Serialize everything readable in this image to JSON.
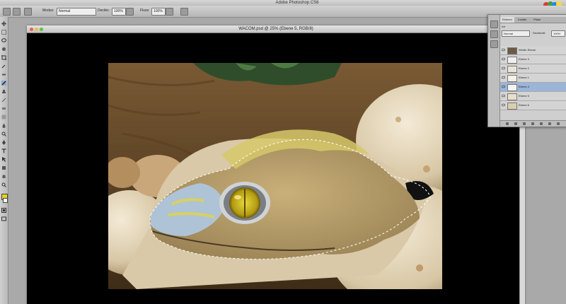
{
  "app": {
    "title": "Adobe Photoshop CS6"
  },
  "options_bar": {
    "mode_label": "Modus:",
    "mode_value": "Normal",
    "opacity_label": "Deckkr.:",
    "opacity_value": "100%",
    "flow_label": "Fluss:",
    "flow_value": "100%"
  },
  "document": {
    "title": "WACOM.psd @ 25% (Ebene 5, RGB/8)"
  },
  "layers_panel": {
    "tabs": [
      "Ebenen",
      "Kanäle",
      "Pfade"
    ],
    "filter_label": "Art",
    "blend_value": "Normal",
    "opacity_label": "Deckkraft:",
    "opacity_value": "100%",
    "layers": [
      {
        "name": "Weiße Ebene"
      },
      {
        "name": "Ebene 3"
      },
      {
        "name": "Ebene 2"
      },
      {
        "name": "Ebene 1"
      },
      {
        "name": "Ebene 4"
      },
      {
        "name": "Ebene 5"
      },
      {
        "name": "Ebene 6"
      }
    ],
    "selected_layer_index": 4
  },
  "colors": {
    "selection_highlight": "#9bb5d9",
    "app_background": "#a9a9a9",
    "foreground_swatch": "#e6d21a"
  }
}
